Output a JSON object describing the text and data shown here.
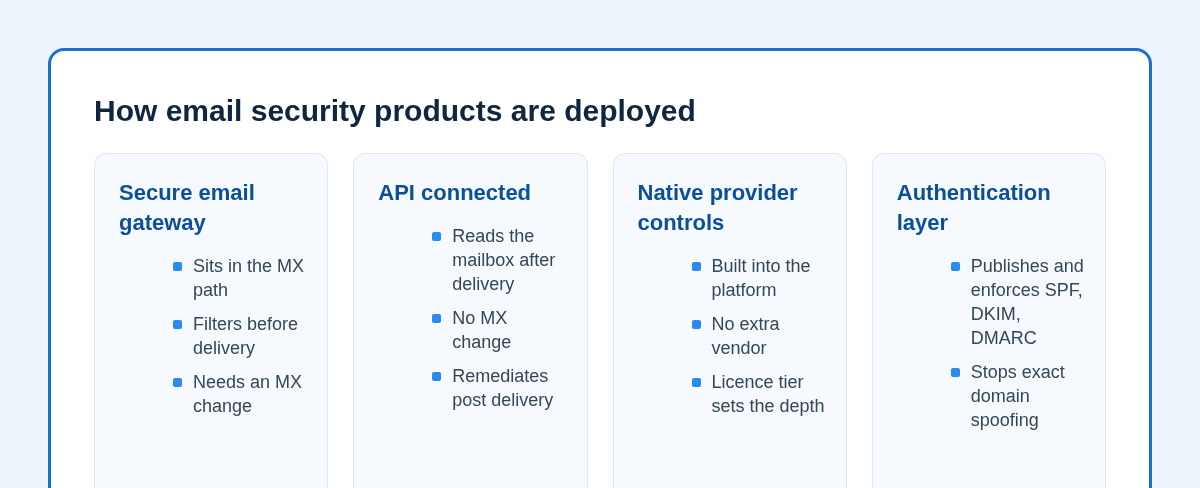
{
  "title": "How email security products are deployed",
  "cards": [
    {
      "heading": "Secure email gateway",
      "points": [
        "Sits in the MX path",
        "Filters before delivery",
        "Needs an MX change"
      ]
    },
    {
      "heading": "API connected",
      "points": [
        "Reads the mailbox after delivery",
        "No MX change",
        "Remediates post delivery"
      ]
    },
    {
      "heading": "Native provider controls",
      "points": [
        "Built into the platform",
        "No extra vendor",
        "Licence tier sets the depth"
      ]
    },
    {
      "heading": "Authentication layer",
      "points": [
        "Publishes and enforces SPF, DKIM, DMARC",
        "Stops exact domain spoofing"
      ]
    }
  ]
}
